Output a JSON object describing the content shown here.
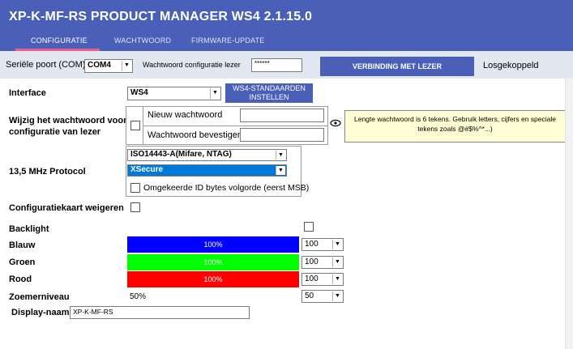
{
  "header": {
    "title": "XP-K-MF-RS   PRODUCT MANAGER WS4 2.1.15.0",
    "tabs": [
      {
        "label": "CONFIGURATIE",
        "active": true
      },
      {
        "label": "WACHTWOORD",
        "active": false
      },
      {
        "label": "FIRMWARE-UPDATE",
        "active": false
      }
    ]
  },
  "connection": {
    "port_label": "Seriële poort (COM)",
    "port_value": "COM4",
    "password_label": "Wachtwoord configuratie lezer",
    "password_value": "******",
    "connect_button": "VERBINDING MET LEZER",
    "status": "Losgekoppeld"
  },
  "form": {
    "interface": {
      "label": "Interface",
      "value": "WS4",
      "defaults_button_line1": "WS4-STANDAARDEN",
      "defaults_button_line2": "INSTELLEN"
    },
    "password": {
      "label_line1": "Wijzig het wachtwoord voor",
      "label_line2": "configuratie van lezer",
      "new_label": "Nieuw wachtwoord",
      "confirm_label": "Wachtwoord bevestigen",
      "hint_line1": "Lengte wachtwoord is 6 tekens. Gebruik letters, cijfers en speciale",
      "hint_line2": "tekens zoals @#$%^*...)"
    },
    "protocol": {
      "label": "13,5 MHz Protocol",
      "protocol_value": "ISO14443-A(Mifare, NTAG)",
      "variant_value": "XSecure",
      "reverse_label": "Omgekeerde ID bytes volgorde (eerst MSB)"
    },
    "reject_card_label": "Configuratiekaart weigeren",
    "backlight": {
      "label": "Backlight",
      "channels": [
        {
          "name": "Blauw",
          "percent": "100%",
          "value": "100",
          "color": "#0000ff"
        },
        {
          "name": "Groen",
          "percent": "100%",
          "value": "100",
          "color": "#00ff00"
        },
        {
          "name": "Rood",
          "percent": "100%",
          "value": "100",
          "color": "#ff0000"
        }
      ]
    },
    "zoom": {
      "label": "Zoemerniveau",
      "percent": "50%",
      "value": "50"
    },
    "display_name": {
      "label": "Display-naam",
      "value": "XP-K-MF-RS"
    }
  },
  "colors": {
    "header": "#4a5fb8",
    "accent": "#ef5c8f",
    "toolbar": "#e1e8f2"
  }
}
